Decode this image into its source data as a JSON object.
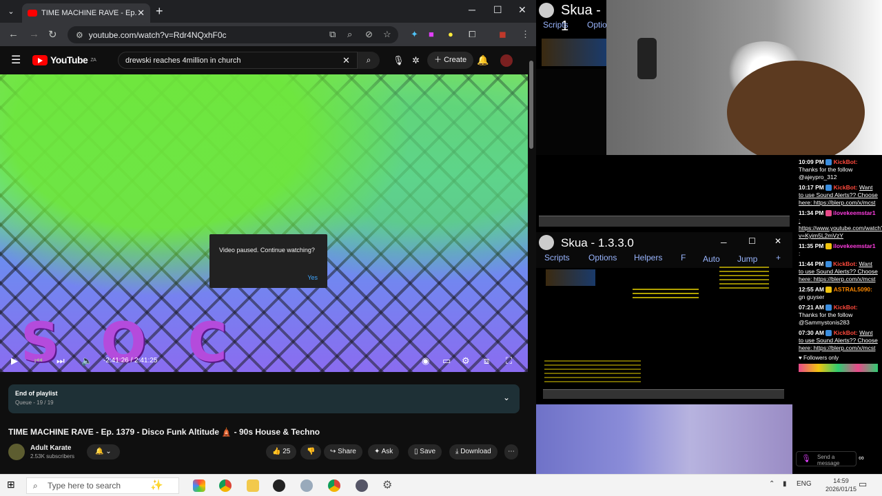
{
  "browser": {
    "tab_title": "TIME MACHINE RAVE - Ep.",
    "url": "youtube.com/watch?v=Rdr4NQxhF0c",
    "new_tab": "+",
    "win_min": "─",
    "win_max": "☐",
    "win_close": "✕"
  },
  "youtube": {
    "logo": "YouTube",
    "region": "ZA",
    "search_query": "drewski reaches 4million in church",
    "create_label": "Create",
    "video_overlay_text": "SOC",
    "dialog_text": "Video paused. Continue watching?",
    "dialog_yes": "Yes",
    "time": "-2:41:26 / 2:41:25",
    "progress": 1.0,
    "playlist_title": "End of playlist",
    "playlist_queue": "Queue - 19 / 19",
    "video_title": "TIME MACHINE RAVE - Ep. 1379 - Disco Funk Altitude 🛕 - 90s House & Techno",
    "channel_name": "Adult Karate",
    "subscribers": "2.53K subscribers",
    "likes": "25",
    "share": "Share",
    "ask": "Ask",
    "save": "Save",
    "download": "Download"
  },
  "skua1": {
    "title": "Skua - 1",
    "menu_scripts": "Scripts",
    "menu_options": "Optio"
  },
  "skua2": {
    "title": "Skua - 1.3.3.0",
    "menu": [
      "Scripts",
      "Options",
      "Helpers",
      "F",
      "Auto",
      "Jump",
      "+"
    ]
  },
  "chat": {
    "messages": [
      {
        "time": "10:09 PM",
        "user": "KickBot:",
        "text": "Thanks for the follow @ajeypro_312"
      },
      {
        "time": "10:17 PM",
        "user": "KickBot:",
        "text": "Want to use Sound Alerts?? Choose here: https://blerp.com/x/mcst"
      },
      {
        "time": "11:34 PM",
        "user": "ilovekeemstar1",
        "text": ": https://www.youtube.com/watch?v=Kyim5L2mVzY"
      },
      {
        "time": "11:35 PM",
        "user": "ilovekeemstar1",
        "text": ":"
      },
      {
        "time": "11:44 PM",
        "user": "KickBot:",
        "text": "Want to use Sound Alerts?? Choose here: https://blerp.com/x/mcst"
      },
      {
        "time": "12:55 AM",
        "user": "ASTRAL5090:",
        "text": "gn guyser"
      },
      {
        "time": "07:21 AM",
        "user": "KickBot:",
        "text": "Thanks for the follow @Sammystonis283"
      },
      {
        "time": "07:30 AM",
        "user": "KickBot:",
        "text": "Want to use Sound Alerts?? Choose here: https://blerp.com/x/mcst"
      }
    ],
    "followers_only": "♥ Followers only",
    "send_placeholder": "Send a message"
  },
  "taskbar": {
    "search_placeholder": "Type here to search",
    "lang": "ENG",
    "time": "14:59",
    "date": "2026/01/15"
  }
}
